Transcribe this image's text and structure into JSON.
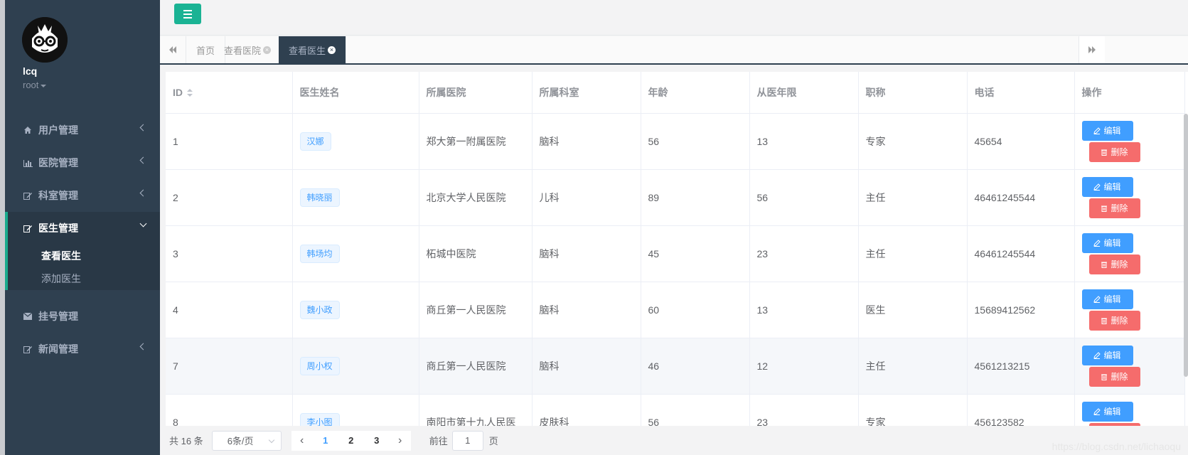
{
  "user": {
    "name": "lcq",
    "role": "root"
  },
  "sidebar": {
    "items": [
      {
        "label": "用户管理",
        "icon": "home-icon"
      },
      {
        "label": "医院管理",
        "icon": "bar-chart-icon"
      },
      {
        "label": "科室管理",
        "icon": "edit-icon"
      }
    ],
    "active_group": {
      "label": "医生管理",
      "icon": "edit-icon",
      "children": [
        {
          "label": "查看医生",
          "active": true
        },
        {
          "label": "添加医生",
          "active": false
        }
      ]
    },
    "items_after": [
      {
        "label": "挂号管理",
        "icon": "envelope-icon"
      },
      {
        "label": "新闻管理",
        "icon": "edit-icon"
      }
    ]
  },
  "tabs": [
    {
      "label": "首页",
      "closable": false,
      "active": false
    },
    {
      "label": "查看医院",
      "closable": true,
      "active": false
    },
    {
      "label": "查看医生",
      "closable": true,
      "active": true
    }
  ],
  "table": {
    "columns": [
      "ID",
      "医生姓名",
      "所属医院",
      "所属科室",
      "年龄",
      "从医年限",
      "职称",
      "电话",
      "操作"
    ],
    "rows": [
      {
        "id": "1",
        "name": "汉娜",
        "hospital": "郑大第一附属医院",
        "dept": "脑科",
        "age": "56",
        "years": "13",
        "title": "专家",
        "phone": "45654"
      },
      {
        "id": "2",
        "name": "韩晓丽",
        "hospital": "北京大学人民医院",
        "dept": "儿科",
        "age": "89",
        "years": "56",
        "title": "主任",
        "phone": "46461245544"
      },
      {
        "id": "3",
        "name": "韩场均",
        "hospital": "柘城中医院",
        "dept": "脑科",
        "age": "45",
        "years": "23",
        "title": "主任",
        "phone": "46461245544"
      },
      {
        "id": "4",
        "name": "魏小政",
        "hospital": "商丘第一人民医院",
        "dept": "脑科",
        "age": "60",
        "years": "13",
        "title": "医生",
        "phone": "15689412562"
      },
      {
        "id": "7",
        "name": "周小权",
        "hospital": "商丘第一人民医院",
        "dept": "脑科",
        "age": "46",
        "years": "12",
        "title": "主任",
        "phone": "4561213215"
      },
      {
        "id": "8",
        "name": "李小图",
        "hospital": "南阳市第十九人民医",
        "dept": "皮肤科",
        "age": "56",
        "years": "23",
        "title": "专家",
        "phone": "456123582"
      }
    ],
    "edit_label": "编辑",
    "delete_label": "删除"
  },
  "pager": {
    "total": "共 16 条",
    "page_size": "6条/页",
    "pages": [
      "1",
      "2",
      "3"
    ],
    "current": "1",
    "goto_label": "前往",
    "goto_value": "1",
    "goto_unit": "页"
  },
  "watermark": "https://blog.csdn.net/lichaoqu",
  "colors": {
    "sidebar_bg": "#2f4050",
    "accent": "#1ab394",
    "edit": "#409eff",
    "delete": "#f56c6c"
  }
}
